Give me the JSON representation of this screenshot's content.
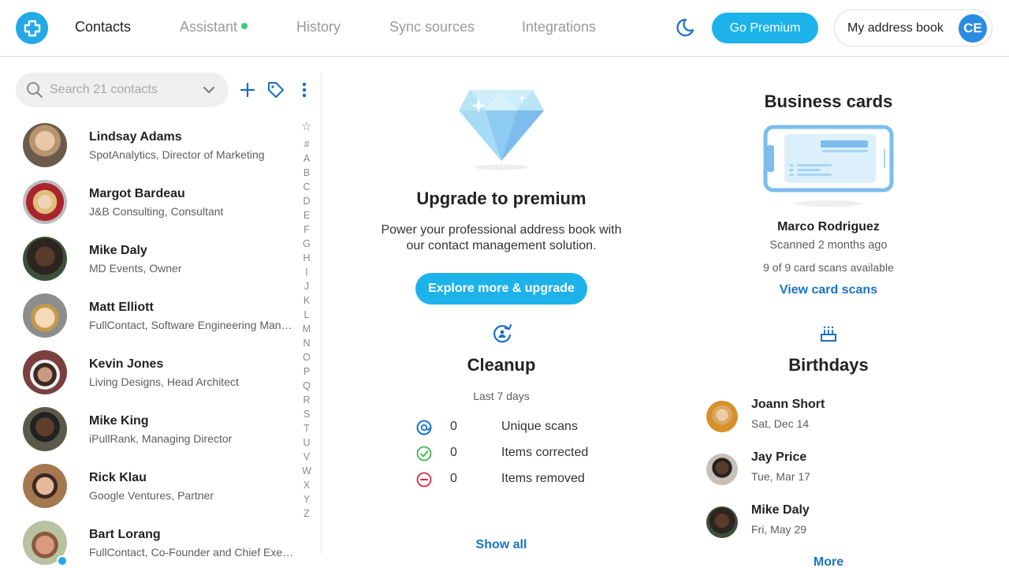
{
  "header": {
    "nav": [
      {
        "label": "Contacts",
        "active": true
      },
      {
        "label": "Assistant",
        "has_dot": true
      },
      {
        "label": "History"
      },
      {
        "label": "Sync sources"
      },
      {
        "label": "Integrations"
      }
    ],
    "theme_icon": "moon-icon",
    "premium_label": "Go Premium",
    "address_book_label": "My address book",
    "user_initials": "CE"
  },
  "contacts": {
    "search_placeholder": "Search 21 contacts",
    "search_value": "",
    "toolbar_icons": [
      "plus-icon",
      "tag-icon",
      "more-vertical-icon"
    ],
    "items": [
      {
        "name": "Lindsay Adams",
        "subtitle": "SpotAnalytics, Director of Marketing"
      },
      {
        "name": "Margot Bardeau",
        "subtitle": "J&B Consulting, Consultant"
      },
      {
        "name": "Mike Daly",
        "subtitle": "MD Events, Owner"
      },
      {
        "name": "Matt Elliott",
        "subtitle": "FullContact, Software Engineering Mana..."
      },
      {
        "name": "Kevin Jones",
        "subtitle": "Living Designs, Head Architect"
      },
      {
        "name": "Mike King",
        "subtitle": "iPullRank, Managing Director"
      },
      {
        "name": "Rick Klau",
        "subtitle": "Google Ventures, Partner"
      },
      {
        "name": "Bart Lorang",
        "subtitle": "FullContact, Co-Founder and Chief Exec...",
        "online": true
      }
    ],
    "alphabet": [
      "☆",
      "#",
      "A",
      "B",
      "C",
      "D",
      "E",
      "F",
      "G",
      "H",
      "I",
      "J",
      "K",
      "L",
      "M",
      "N",
      "O",
      "P",
      "Q",
      "R",
      "S",
      "T",
      "U",
      "V",
      "W",
      "X",
      "Y",
      "Z"
    ]
  },
  "premium": {
    "title": "Upgrade to premium",
    "description_line1": "Power your professional address book with",
    "description_line2": "our contact management solution.",
    "button_label": "Explore more & upgrade"
  },
  "cleanup": {
    "title": "Cleanup",
    "period": "Last 7 days",
    "stats": [
      {
        "icon": "scan-icon",
        "value": "0",
        "label": "Unique scans",
        "color": "#1a74c4"
      },
      {
        "icon": "check-circle-icon",
        "value": "0",
        "label": "Items corrected",
        "color": "#3cb94a"
      },
      {
        "icon": "minus-circle-icon",
        "value": "0",
        "label": "Items removed",
        "color": "#d9283a"
      }
    ],
    "show_all_label": "Show all"
  },
  "business_cards": {
    "title": "Business cards",
    "contact_name": "Marco Rodriguez",
    "scanned": "Scanned 2 months ago",
    "available": "9 of 9 card scans available",
    "link_label": "View card scans"
  },
  "birthdays": {
    "title": "Birthdays",
    "items": [
      {
        "name": "Joann Short",
        "date": "Sat, Dec 14"
      },
      {
        "name": "Jay Price",
        "date": "Tue, Mar 17"
      },
      {
        "name": "Mike Daly",
        "date": "Fri, May 29"
      }
    ],
    "more_label": "More"
  },
  "colors": {
    "accent": "#1db2ea",
    "link": "#1a74c4",
    "avatar": "#2a8ce0",
    "online_dot": "#3ec97a"
  }
}
